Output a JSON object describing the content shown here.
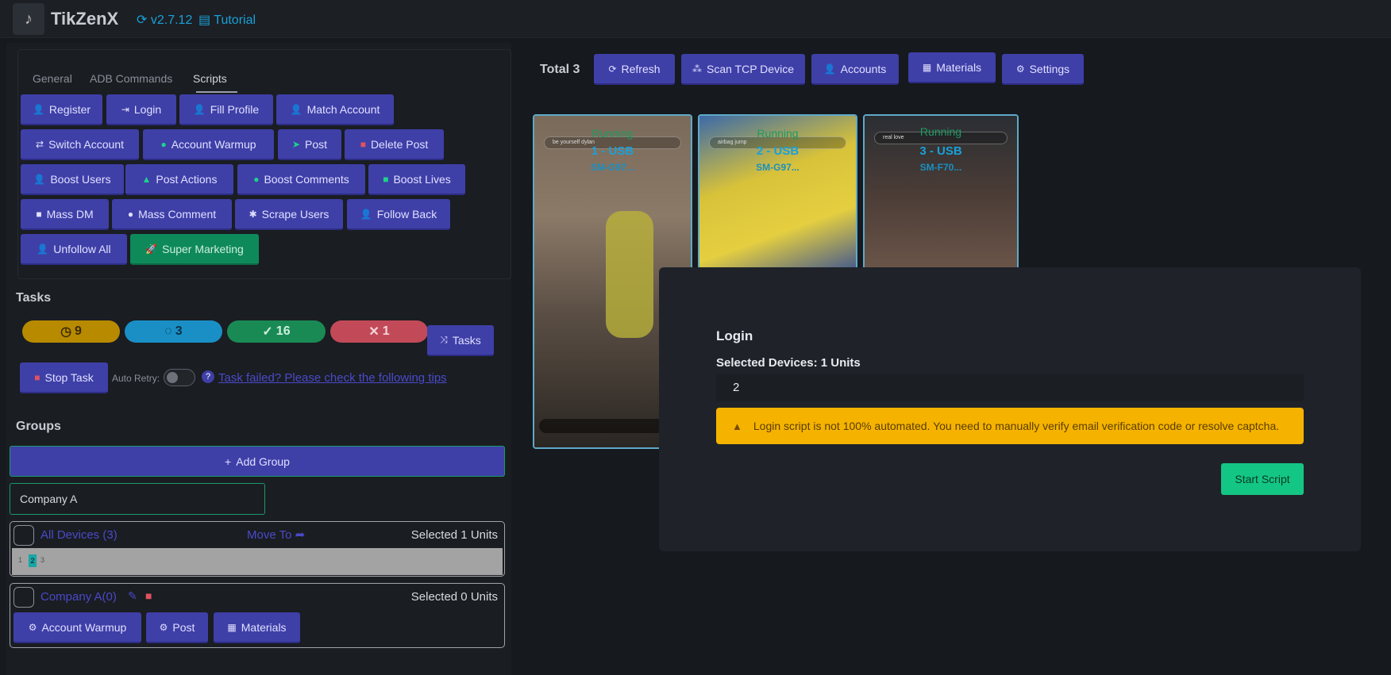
{
  "header": {
    "title": "TikZenX",
    "version": "v2.7.12",
    "tutorial": "Tutorial"
  },
  "tabs": [
    "General",
    "ADB Commands",
    "Scripts"
  ],
  "script_buttons": [
    "Register",
    "Login",
    "Fill Profile",
    "Match Account",
    "Switch Account",
    "Account Warmup",
    "Post",
    "Delete Post",
    "Boost Users",
    "Post Actions",
    "Boost Comments",
    "Boost Lives",
    "Mass DM",
    "Mass Comment",
    "Scrape Users",
    "Follow Back",
    "Unfollow All",
    "Super Marketing"
  ],
  "tasks": {
    "title": "Tasks",
    "pending": "9",
    "running": "3",
    "done": "16",
    "failed": "1",
    "tasks_label": "Tasks",
    "stop_label": "Stop Task",
    "auto_retry_label": "Auto Retry:",
    "tips_link": "Task failed? Please check the following tips"
  },
  "groups": {
    "title": "Groups",
    "add_label": "Add Group",
    "name_value": "Company A",
    "all_devices": "All Devices (3)",
    "move_to": "Move To",
    "all_selected": "Selected 1 Units",
    "device_chips": [
      "1",
      "2",
      "3"
    ],
    "company_name": "Company A(0)",
    "company_selected": "Selected 0 Units",
    "company_buttons": [
      "Account Warmup",
      "Post",
      "Materials"
    ]
  },
  "toolbar": {
    "total": "Total 3",
    "refresh": "Refresh",
    "scan": "Scan TCP Device",
    "accounts": "Accounts",
    "materials": "Materials",
    "settings": "Settings"
  },
  "devices": [
    {
      "status": "Running",
      "usb": "1 - USB",
      "model": "SM-G97...",
      "search": "be yourself dylan"
    },
    {
      "status": "Running",
      "usb": "2 - USB",
      "model": "SM-G97...",
      "search": "airbag jump"
    },
    {
      "status": "Running",
      "usb": "3 - USB",
      "model": "SM-F70...",
      "search": "real love"
    }
  ],
  "modal": {
    "title": "Login",
    "subtitle": "Selected Devices: 1 Units",
    "input_value": "2",
    "warning": "Login script is not 100% automated. You need to manually verify email verification code or resolve captcha.",
    "start_label": "Start Script"
  },
  "colors": {
    "accent": "#3f3fa8",
    "success": "#14c684",
    "warning": "#f5b300",
    "link": "#1aa0d8"
  }
}
